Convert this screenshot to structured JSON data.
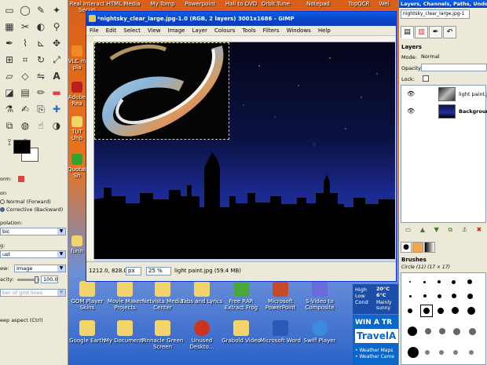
{
  "desktop": {
    "top_icons": [
      {
        "label": "Real Interact Securi"
      },
      {
        "label": "HTML Media"
      },
      {
        "label": "My Tomp"
      },
      {
        "label": "Powerpoint"
      },
      {
        "label": "Hall to DVD"
      },
      {
        "label": "Orbit Tune"
      },
      {
        "label": "Notepad"
      },
      {
        "label": "TopQCR"
      },
      {
        "label": "Wel"
      }
    ],
    "side_icons": [
      {
        "label": "VLC m pla"
      },
      {
        "label": "Adobe Rea"
      },
      {
        "label": "TUT Unp"
      },
      {
        "label": "Quotation Sh"
      },
      {
        "label": "funn"
      }
    ],
    "bottom_row1": [
      {
        "label": "GOM Player Skins"
      },
      {
        "label": "Movie Maker Projects"
      },
      {
        "label": "Netvista Media Center"
      },
      {
        "label": "Tabs and Lyrics"
      },
      {
        "label": "Free RAR Extract Frog"
      },
      {
        "label": "Microsoft PowerPoint"
      },
      {
        "label": "S-Video to Composite"
      }
    ],
    "bottom_row2": [
      {
        "label": "Google Earth"
      },
      {
        "label": "My Documents"
      },
      {
        "label": "Pinnacle Green Screen"
      },
      {
        "label": "Unused Deskto..."
      },
      {
        "label": "Grabold Video"
      },
      {
        "label": "Microsoft Word"
      },
      {
        "label": "Swiff Player"
      }
    ],
    "weather": {
      "labels": [
        "High",
        "Low",
        "Cond"
      ],
      "high": "20°C",
      "low": "6°C",
      "cond": "Mainly sunny"
    },
    "ad": {
      "line1": "WIN A TR",
      "line2": "TravelA",
      "bullet1": "• Weather Maps",
      "bullet2": "• Weather Came"
    }
  },
  "toolbox": {
    "tools": [
      "rect-select",
      "ellipse-select",
      "free-select",
      "fuzzy-select",
      "by-color",
      "scissors",
      "foreground-select",
      "paths",
      "color-picker",
      "zoom",
      "measure",
      "move",
      "align",
      "crop",
      "rotate",
      "scale",
      "shear",
      "perspective",
      "flip",
      "text",
      "bucket",
      "blend",
      "pencil",
      "paintbrush",
      "eraser",
      "airbrush",
      "ink",
      "clone",
      "heal",
      "perspective-clone",
      "convolve",
      "smudge",
      "dodge",
      "",
      "",
      ""
    ],
    "colors": {
      "foreground": "#000000",
      "background": "#ffffff"
    },
    "options": {
      "transform_label": "orm:",
      "direction_label": "on",
      "normal_forward": "Normal (Forward)",
      "corrective_backward": "Corrective (Backward)",
      "interpolation_label": "polation:",
      "interpolation_value": "bic",
      "clipping_label": "g:",
      "clipping_value": "ust",
      "preview_label": "ew:",
      "preview_value": "Image",
      "opacity_label": "acity:",
      "opacity_value": "100.0",
      "grid_value": "ber of grid lines",
      "keep_aspect": "eep aspect  (Ctrl)"
    }
  },
  "image_window": {
    "title": "*nightsky_clear_large.jpg-1.0 (RGB, 2 layers) 3001x1686 - GIMP",
    "menu": [
      "File",
      "Edit",
      "Select",
      "View",
      "Image",
      "Layer",
      "Colours",
      "Tools",
      "Filters",
      "Windows",
      "Help"
    ],
    "status": {
      "coords": "1212.0, 828.0",
      "unit": "px",
      "zoom": "25 %",
      "info": "light paint.jpg (59.4 MB)"
    }
  },
  "dock": {
    "title": "Layers, Channels, Paths, Undo -",
    "image_select": "nightsky_clear_large.jpg-1",
    "layers_label": "Layers",
    "mode_label": "Mode:",
    "mode_value": "Normal",
    "opacity_label": "Opacity:",
    "lock_label": "Lock:",
    "layers": [
      {
        "name": "light paint.jpg",
        "selected": false
      },
      {
        "name": "Background",
        "selected": false
      }
    ],
    "brushes_label": "Brushes",
    "brush_name": "Circle (11) (17 × 17)"
  }
}
